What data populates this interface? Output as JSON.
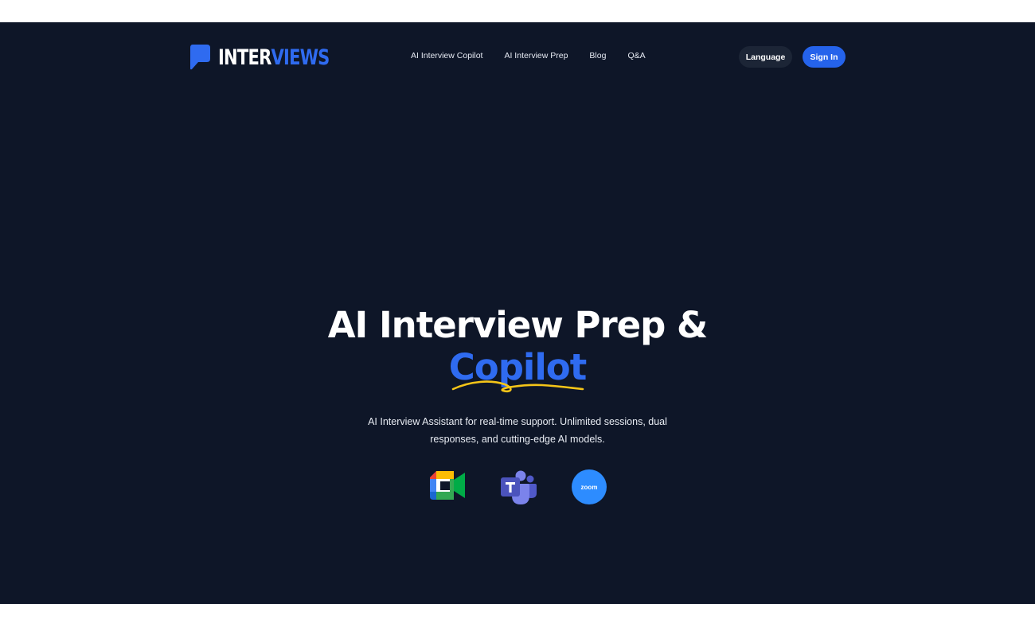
{
  "brand": {
    "name_part1": "INTER",
    "name_part2": "VIEWS",
    "accent_color": "#2f6bf0",
    "icon": "speech-bubble-icon"
  },
  "nav": {
    "links": [
      {
        "label": "AI Interview Copilot"
      },
      {
        "label": "AI Interview Prep"
      },
      {
        "label": "Blog"
      },
      {
        "label": "Q&A"
      }
    ]
  },
  "header_actions": {
    "language_label": "Language",
    "signin_label": "Sign In"
  },
  "hero": {
    "title_line1": "AI Interview Prep &",
    "title_line2": "Copilot",
    "subtitle": "AI Interview Assistant for real-time support. Unlimited sessions, dual responses, and cutting-edge AI models."
  },
  "integrations": {
    "apps": [
      {
        "icon": "google-meet-icon"
      },
      {
        "icon": "microsoft-teams-icon"
      },
      {
        "icon": "zoom-icon",
        "label": "zoom"
      }
    ]
  },
  "colors": {
    "background": "#0e1628",
    "primary": "#2563eb",
    "underline": "#f5c518"
  }
}
